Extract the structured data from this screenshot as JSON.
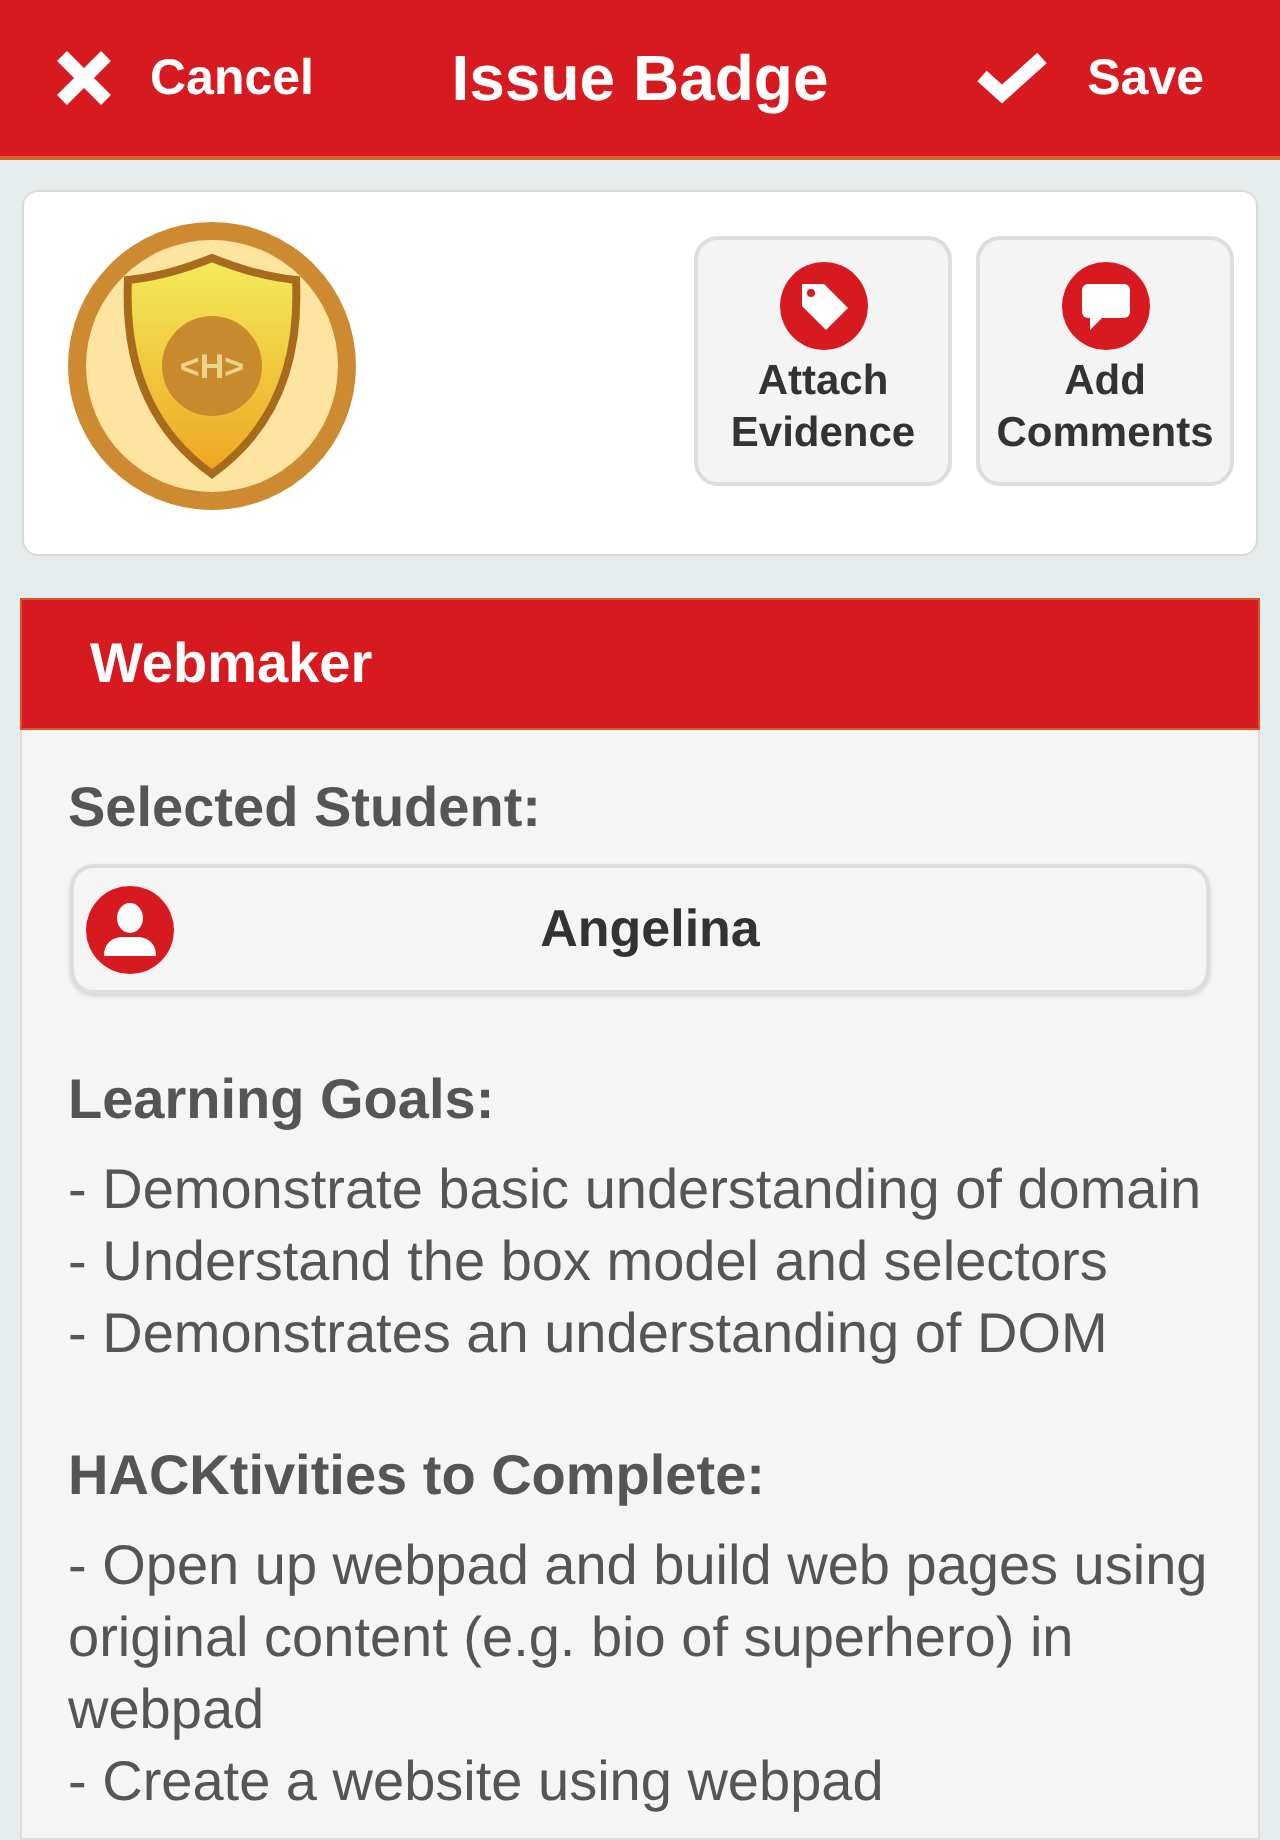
{
  "header": {
    "cancel_button": {
      "label": "Cancel"
    },
    "title": "Issue Badge",
    "save_button": {
      "label": "Save"
    }
  },
  "badge_card": {
    "badge": {
      "emblem": "<H>"
    },
    "actions": [
      {
        "kind": "evidence",
        "label": "Attach Evidence"
      },
      {
        "kind": "comments",
        "label": "Add Comments"
      }
    ]
  },
  "panel": {
    "title": "Webmaker",
    "selected_student": {
      "label": "Selected Student:",
      "name": "Angelina"
    },
    "learning_goals": {
      "heading": "Learning Goals:",
      "items": [
        "- Demonstrate basic understanding of domain",
        "- Understand the box model and selectors",
        "- Demonstrates an understanding of DOM"
      ]
    },
    "hacktivities": {
      "heading": "HACKtivities to Complete:",
      "items": [
        "- Open up webpad and build web pages using original content (e.g. bio of superhero) in webpad",
        "- Create a website using webpad"
      ]
    }
  }
}
